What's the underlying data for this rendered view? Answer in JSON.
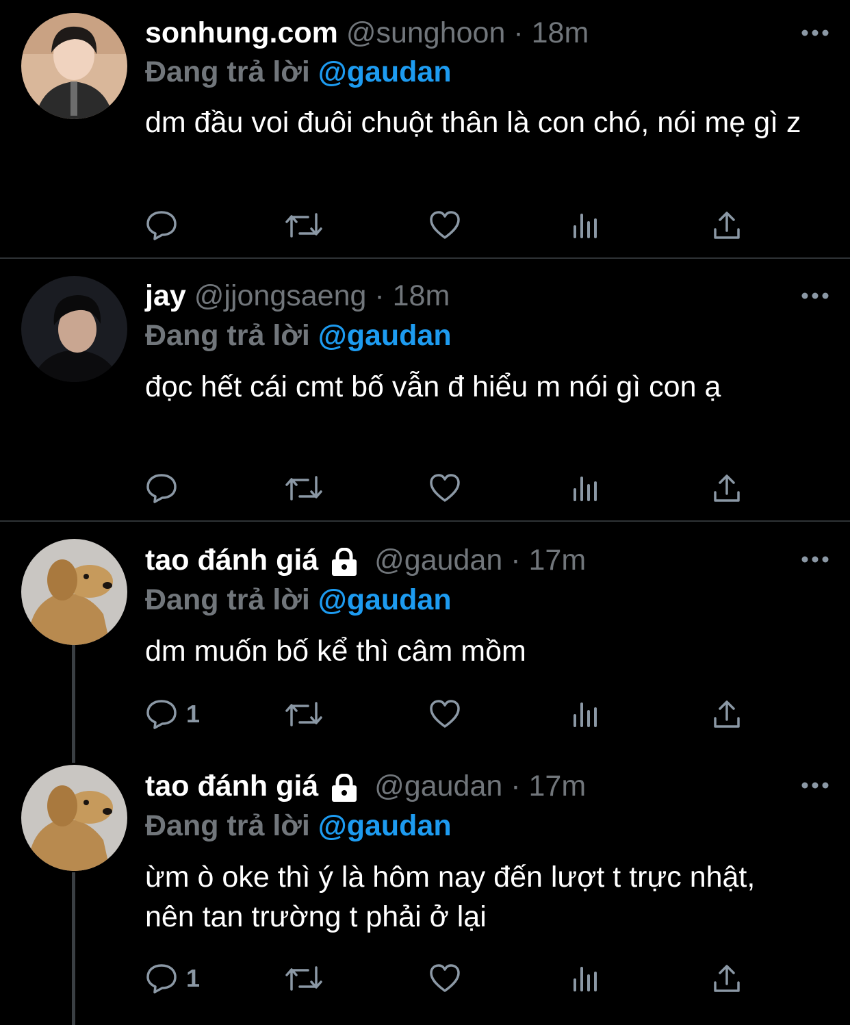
{
  "reply_prefix": "Đang trả lời",
  "tweets": [
    {
      "name": "sonhung.com",
      "handle": "@sunghoon",
      "separator": "·",
      "time": "18m",
      "reply_to": "@gaudan",
      "text": "dm đầu voi đuôi chuột thân là con chó, nói mẹ gì z",
      "locked": false,
      "reply_count": "",
      "avatar": "avatar-man-hoodie"
    },
    {
      "name": "jay",
      "handle": "@jjongsaeng",
      "separator": "·",
      "time": "18m",
      "reply_to": "@gaudan",
      "text": "đọc hết cái cmt bố vẫn đ hiểu m nói gì con ạ",
      "locked": false,
      "reply_count": "",
      "avatar": "avatar-man-dark"
    },
    {
      "name": "tao đánh giá",
      "handle": "@gaudan",
      "separator": "·",
      "time": "17m",
      "reply_to": "@gaudan",
      "text": "dm muốn bố kể thì câm mồm",
      "locked": true,
      "reply_count": "1",
      "avatar": "avatar-dog"
    },
    {
      "name": "tao đánh giá",
      "handle": "@gaudan",
      "separator": "·",
      "time": "17m",
      "reply_to": "@gaudan",
      "text": "ừm ò oke thì ý là hôm nay đến lượt t trực nhật, nên tan trường t phải ở lại",
      "locked": true,
      "reply_count": "1",
      "avatar": "avatar-dog"
    }
  ],
  "icons": [
    "reply-icon",
    "retweet-icon",
    "like-icon",
    "views-icon",
    "share-icon",
    "more-icon",
    "lock-icon"
  ],
  "colors": {
    "background": "#000000",
    "mention": "#1d9bf0",
    "muted": "#71767b",
    "divider": "#2f3336"
  }
}
